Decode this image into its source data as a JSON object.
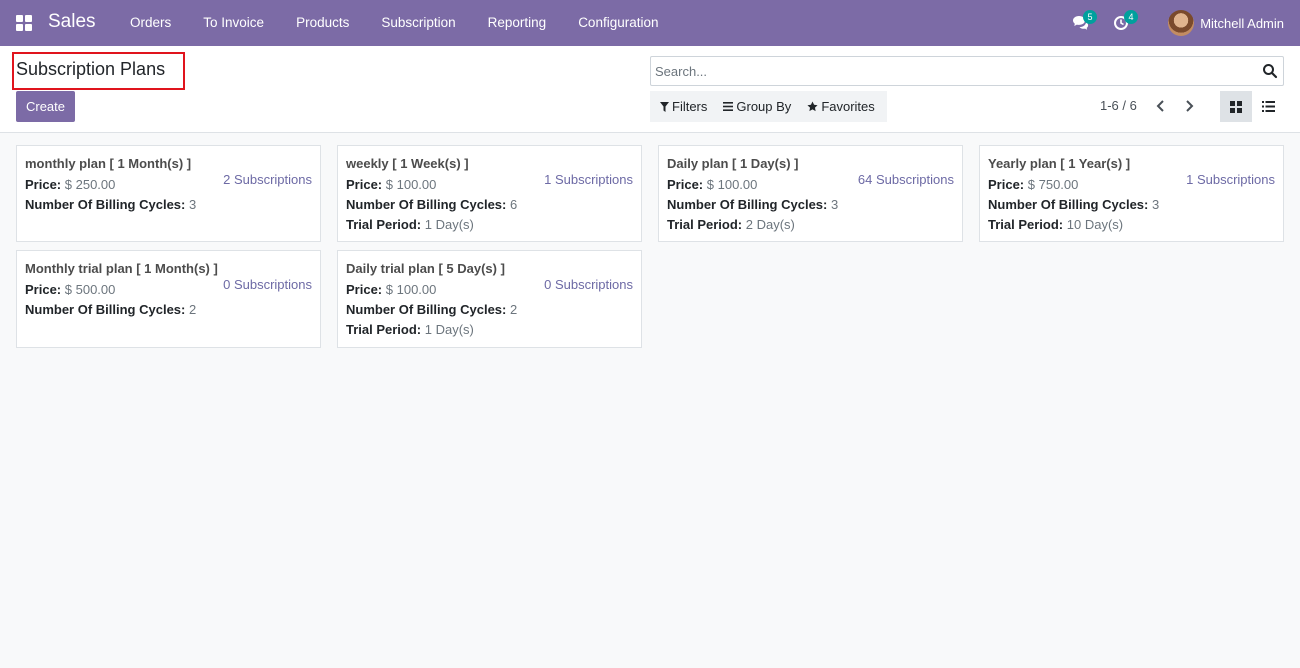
{
  "navbar": {
    "brand": "Sales",
    "menu": [
      "Orders",
      "To Invoice",
      "Products",
      "Subscription",
      "Reporting",
      "Configuration"
    ],
    "messages_count": "5",
    "activities_count": "4",
    "user_name": "Mitchell Admin"
  },
  "control_panel": {
    "title": "Subscription Plans",
    "create_label": "Create",
    "search_placeholder": "Search...",
    "filters_label": "Filters",
    "group_by_label": "Group By",
    "favorites_label": "Favorites",
    "pager": "1-6 / 6"
  },
  "labels": {
    "price": "Price:",
    "billing_cycles": "Number Of Billing Cycles:",
    "trial_period": "Trial Period:"
  },
  "plans": [
    {
      "name": "monthly plan [ 1 Month(s) ]",
      "price": "$ 250.00",
      "billing_cycles": "3",
      "trial_period": "",
      "subscriptions": "2 Subscriptions"
    },
    {
      "name": "weekly [ 1 Week(s) ]",
      "price": "$ 100.00",
      "billing_cycles": "6",
      "trial_period": "1 Day(s)",
      "subscriptions": "1 Subscriptions"
    },
    {
      "name": "Daily plan [ 1 Day(s) ]",
      "price": "$ 100.00",
      "billing_cycles": "3",
      "trial_period": "2 Day(s)",
      "subscriptions": "64 Subscriptions"
    },
    {
      "name": "Yearly plan [ 1 Year(s) ]",
      "price": "$ 750.00",
      "billing_cycles": "3",
      "trial_period": "10 Day(s)",
      "subscriptions": "1 Subscriptions"
    },
    {
      "name": "Monthly trial plan [ 1 Month(s) ]",
      "price": "$ 500.00",
      "billing_cycles": "2",
      "trial_period": "",
      "subscriptions": "0 Subscriptions"
    },
    {
      "name": "Daily trial plan [ 5 Day(s) ]",
      "price": "$ 100.00",
      "billing_cycles": "2",
      "trial_period": "1 Day(s)",
      "subscriptions": "0 Subscriptions"
    }
  ],
  "colors": {
    "brand": "#7c6ba6",
    "link": "#6d6aa5",
    "badge": "#00a09d",
    "highlight_border": "#e0141d"
  }
}
